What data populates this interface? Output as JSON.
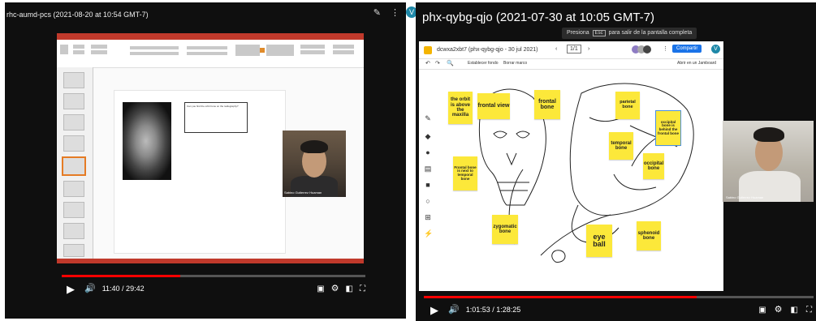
{
  "left_player": {
    "title": "rhc-aumd-pcs (2021-08-20 at 10:54 GMT-7)",
    "avatar_letter": "V",
    "time": "11:40 / 29:42",
    "progress_fraction": 0.39,
    "slide_question": "Can you find the orbit bone on the radiography?",
    "participant_name": "Sabino Gutierrez Huaman",
    "icons": [
      "pen-icon",
      "more-icon",
      "play-icon",
      "volume-icon",
      "subtitles-icon",
      "gear-icon",
      "miniplayer-icon",
      "fullscreen-icon"
    ]
  },
  "right_player": {
    "title": "phx-qybg-qjo (2021-07-30 at 10:05 GMT-7)",
    "toast_before": "Presiona",
    "toast_key": "Esc",
    "toast_after": "para salir de la pantalla completa",
    "doc_title": "dcwxa2xbt7 (phx-qybg-qjo - 30 jul 2021)",
    "page_nav": "1/1",
    "share_button": "Compartir",
    "avatar_letter": "V",
    "toolbar_bg": "Establecer fondo",
    "toolbar_clear": "Borrar marco",
    "open_jamboard": "Abrir en un Jamboard",
    "time": "1:01:53 / 1:28:25",
    "progress_fraction": 0.7,
    "participant_name": "Sabino Gutierrez Huaman",
    "stickies": {
      "orbit": "the orbit is above the maxilla",
      "frontal_view": "frontal view",
      "frontal_bone": "frontal bone",
      "parietal": "parietal bone",
      "occipital_note": "occipital bone is behind the frontal bone",
      "temporal": "temporal bone",
      "occipital": "occipital bone",
      "frontal_next": "Frontal bone is next to temporal bone",
      "zygomatic": "zygomatic bone",
      "eye_ball": "eye ball",
      "sphenoid": "sphenoid bone"
    }
  },
  "colors": {
    "progress": "#ff0000",
    "sticky": "#fce83a",
    "share": "#1a73e8",
    "ppt_red": "#c0392b",
    "avatar": "#1e88a8"
  }
}
